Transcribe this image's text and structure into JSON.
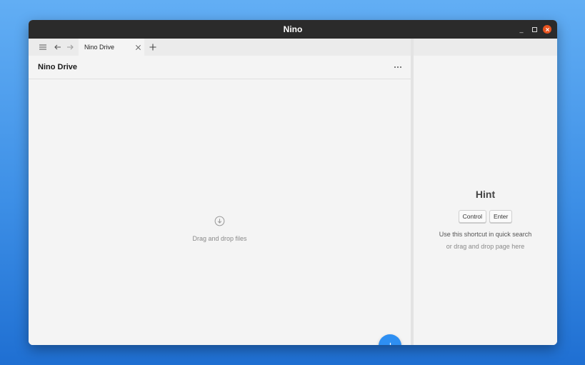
{
  "window": {
    "title": "Nino",
    "close_color": "#e95420",
    "minimize_icon": "minimize-icon",
    "maximize_icon": "maximize-icon",
    "close_icon": "close-icon"
  },
  "tabbar": {
    "icons": [
      "menu-icon",
      "back-arrow-icon",
      "forward-arrow-icon"
    ],
    "tabs": [
      {
        "label": "Nino Drive",
        "close_icon": "close-icon"
      }
    ],
    "new_tab_icon": "plus-icon"
  },
  "page": {
    "title": "Nino Drive",
    "more_icon": "more-horizontal-icon"
  },
  "drop_zone": {
    "icon": "download-circle-icon",
    "text": "Drag and drop files"
  },
  "fab": {
    "icon": "plus-icon",
    "color": "#2e8ff2"
  },
  "hint": {
    "title": "Hint",
    "keys": [
      "Control",
      "Enter"
    ],
    "line1": "Use this shortcut in quick search",
    "line2": "or drag and drop page here"
  }
}
